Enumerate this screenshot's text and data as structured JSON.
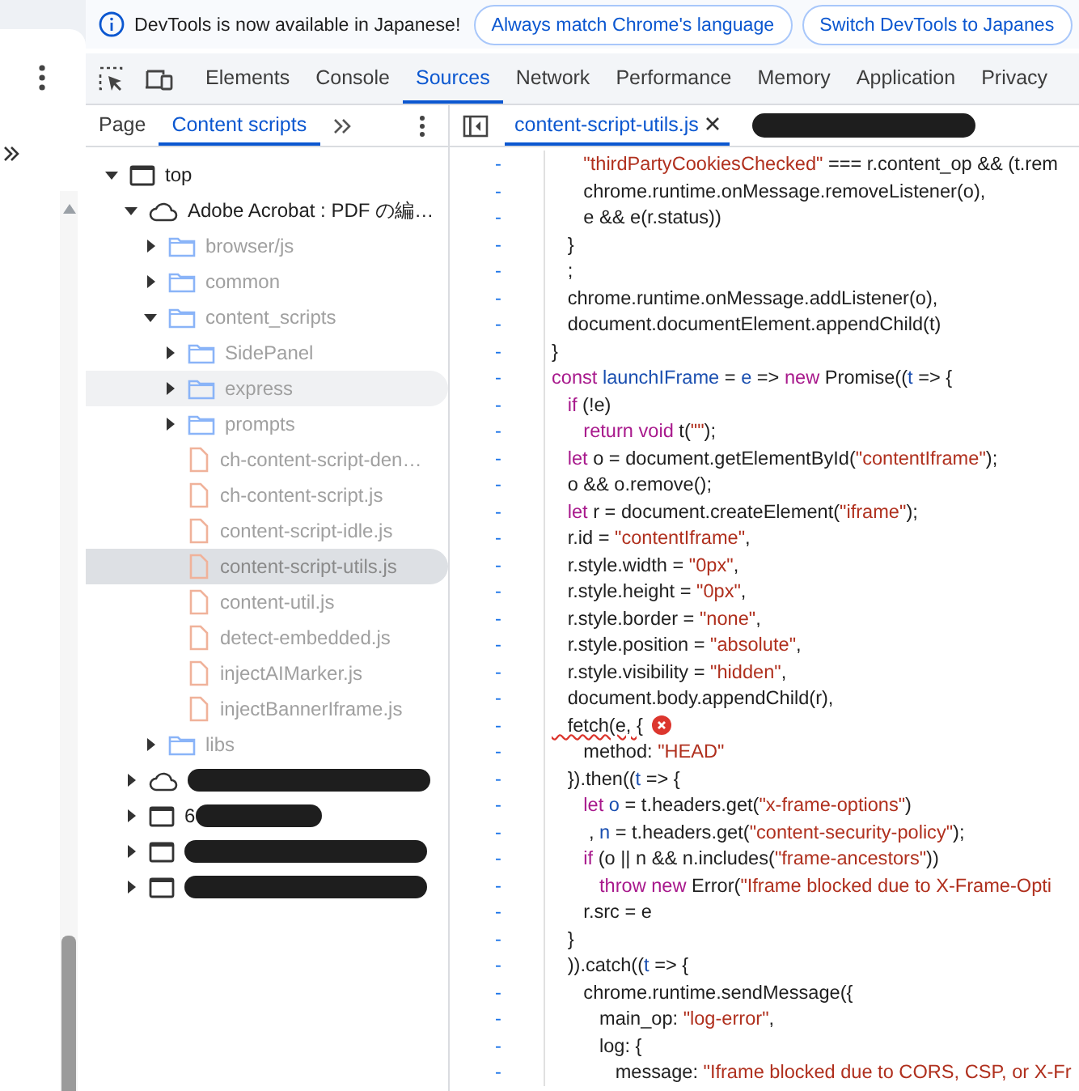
{
  "infobar": {
    "message": "DevTools is now available in Japanese!",
    "buttons": [
      "Always match Chrome's language",
      "Switch DevTools to Japanes"
    ]
  },
  "main_tabs": [
    {
      "label": "Elements",
      "selected": false
    },
    {
      "label": "Console",
      "selected": false
    },
    {
      "label": "Sources",
      "selected": true
    },
    {
      "label": "Network",
      "selected": false
    },
    {
      "label": "Performance",
      "selected": false
    },
    {
      "label": "Memory",
      "selected": false
    },
    {
      "label": "Application",
      "selected": false
    },
    {
      "label": "Privacy",
      "selected": false
    }
  ],
  "navigator_tabs": [
    {
      "label": "Page",
      "selected": false
    },
    {
      "label": "Content scripts",
      "selected": true
    }
  ],
  "editor_tabs": [
    {
      "label": "content-script-utils.js",
      "selected": true
    },
    {
      "redacted": true
    }
  ],
  "tree": [
    {
      "label": "top",
      "kind": "frame",
      "expanded": true,
      "dimmed": false,
      "selected": false,
      "hovered": false,
      "children": [
        {
          "label": "Adobe Acrobat : PDF の編…",
          "kind": "cloud",
          "expanded": true,
          "dimmed": false,
          "selected": false,
          "hovered": false,
          "children": [
            {
              "label": "browser/js",
              "kind": "folder",
              "expanded": false,
              "dimmed": true,
              "selected": false,
              "hovered": false
            },
            {
              "label": "common",
              "kind": "folder",
              "expanded": false,
              "dimmed": true,
              "selected": false,
              "hovered": false
            },
            {
              "label": "content_scripts",
              "kind": "folder",
              "expanded": true,
              "dimmed": true,
              "selected": false,
              "hovered": false,
              "children": [
                {
                  "label": "SidePanel",
                  "kind": "folder",
                  "expanded": false,
                  "dimmed": true,
                  "selected": false,
                  "hovered": false
                },
                {
                  "label": "express",
                  "kind": "folder",
                  "expanded": false,
                  "dimmed": true,
                  "selected": false,
                  "hovered": true
                },
                {
                  "label": "prompts",
                  "kind": "folder",
                  "expanded": false,
                  "dimmed": true,
                  "selected": false,
                  "hovered": false
                },
                {
                  "label": "ch-content-script-den…",
                  "kind": "file",
                  "dimmed": true,
                  "selected": false,
                  "hovered": false
                },
                {
                  "label": "ch-content-script.js",
                  "kind": "file",
                  "dimmed": true,
                  "selected": false,
                  "hovered": false
                },
                {
                  "label": "content-script-idle.js",
                  "kind": "file",
                  "dimmed": true,
                  "selected": false,
                  "hovered": false
                },
                {
                  "label": "content-script-utils.js",
                  "kind": "file",
                  "dimmed": true,
                  "selected": true,
                  "hovered": false
                },
                {
                  "label": "content-util.js",
                  "kind": "file",
                  "dimmed": true,
                  "selected": false,
                  "hovered": false
                },
                {
                  "label": "detect-embedded.js",
                  "kind": "file",
                  "dimmed": true,
                  "selected": false,
                  "hovered": false
                },
                {
                  "label": "injectAIMarker.js",
                  "kind": "file",
                  "dimmed": true,
                  "selected": false,
                  "hovered": false
                },
                {
                  "label": "injectBannerIframe.js",
                  "kind": "file",
                  "dimmed": true,
                  "selected": false,
                  "hovered": false
                }
              ]
            },
            {
              "label": "libs",
              "kind": "folder",
              "expanded": false,
              "dimmed": true,
              "selected": false,
              "hovered": false
            }
          ]
        },
        {
          "kind": "cloud",
          "expanded": false,
          "dimmed": false,
          "selected": false,
          "hovered": false,
          "redacted": true
        },
        {
          "label": "6",
          "kind": "frame",
          "expanded": false,
          "dimmed": false,
          "selected": false,
          "hovered": false,
          "redacted": true
        },
        {
          "kind": "frame",
          "expanded": false,
          "dimmed": false,
          "selected": false,
          "hovered": false,
          "redacted": true
        },
        {
          "kind": "frame",
          "expanded": false,
          "dimmed": false,
          "selected": false,
          "hovered": false,
          "redacted": true
        }
      ]
    }
  ],
  "code_lines": [
    {
      "marker": "-",
      "tokens": [
        {
          "text": "      \"thirdPartyCookiesChecked\"",
          "kind": "string"
        },
        {
          "text": " === r.content_op && (t.rem",
          "kind": "plain"
        }
      ]
    },
    {
      "marker": "-",
      "tokens": [
        {
          "text": "      chrome.runtime.onMessage.removeListener(o),",
          "kind": "plain"
        }
      ]
    },
    {
      "marker": "-",
      "tokens": [
        {
          "text": "      e && e(r.status))",
          "kind": "plain"
        }
      ]
    },
    {
      "marker": "-",
      "tokens": [
        {
          "text": "   }",
          "kind": "plain"
        }
      ]
    },
    {
      "marker": "-",
      "tokens": [
        {
          "text": "   ;",
          "kind": "plain"
        }
      ]
    },
    {
      "marker": "-",
      "tokens": [
        {
          "text": "   chrome.runtime.onMessage.addListener(o),",
          "kind": "plain"
        }
      ]
    },
    {
      "marker": "-",
      "tokens": [
        {
          "text": "   document.documentElement.appendChild(t)",
          "kind": "plain"
        }
      ]
    },
    {
      "marker": "-",
      "tokens": [
        {
          "text": "}",
          "kind": "plain"
        }
      ]
    },
    {
      "marker": "-",
      "tokens": [
        {
          "text": "const ",
          "kind": "keyword"
        },
        {
          "text": "launchIFrame",
          "kind": "definition"
        },
        {
          "text": " = ",
          "kind": "plain"
        },
        {
          "text": "e",
          "kind": "definition"
        },
        {
          "text": " => ",
          "kind": "plain"
        },
        {
          "text": "new",
          "kind": "keyword"
        },
        {
          "text": " Promise((",
          "kind": "plain"
        },
        {
          "text": "t",
          "kind": "definition"
        },
        {
          "text": " => {",
          "kind": "plain"
        }
      ]
    },
    {
      "marker": "-",
      "tokens": [
        {
          "text": "   if",
          "kind": "keyword"
        },
        {
          "text": " (!e)",
          "kind": "plain"
        }
      ]
    },
    {
      "marker": "-",
      "tokens": [
        {
          "text": "      return void",
          "kind": "keyword"
        },
        {
          "text": " t(",
          "kind": "plain"
        },
        {
          "text": "\"\"",
          "kind": "string"
        },
        {
          "text": ");",
          "kind": "plain"
        }
      ]
    },
    {
      "marker": "-",
      "tokens": [
        {
          "text": "   let",
          "kind": "keyword"
        },
        {
          "text": " o = document.getElementById(",
          "kind": "plain"
        },
        {
          "text": "\"contentIframe\"",
          "kind": "string"
        },
        {
          "text": ");",
          "kind": "plain"
        }
      ]
    },
    {
      "marker": "-",
      "tokens": [
        {
          "text": "   o && o.remove();",
          "kind": "plain"
        }
      ]
    },
    {
      "marker": "-",
      "tokens": [
        {
          "text": "   let",
          "kind": "keyword"
        },
        {
          "text": " r = document.createElement(",
          "kind": "plain"
        },
        {
          "text": "\"iframe\"",
          "kind": "string"
        },
        {
          "text": ");",
          "kind": "plain"
        }
      ]
    },
    {
      "marker": "-",
      "tokens": [
        {
          "text": "   r.id = ",
          "kind": "plain"
        },
        {
          "text": "\"contentIframe\"",
          "kind": "string"
        },
        {
          "text": ",",
          "kind": "plain"
        }
      ]
    },
    {
      "marker": "-",
      "tokens": [
        {
          "text": "   r.style.width = ",
          "kind": "plain"
        },
        {
          "text": "\"0px\"",
          "kind": "string"
        },
        {
          "text": ",",
          "kind": "plain"
        }
      ]
    },
    {
      "marker": "-",
      "tokens": [
        {
          "text": "   r.style.height = ",
          "kind": "plain"
        },
        {
          "text": "\"0px\"",
          "kind": "string"
        },
        {
          "text": ",",
          "kind": "plain"
        }
      ]
    },
    {
      "marker": "-",
      "tokens": [
        {
          "text": "   r.style.border = ",
          "kind": "plain"
        },
        {
          "text": "\"none\"",
          "kind": "string"
        },
        {
          "text": ",",
          "kind": "plain"
        }
      ]
    },
    {
      "marker": "-",
      "tokens": [
        {
          "text": "   r.style.position = ",
          "kind": "plain"
        },
        {
          "text": "\"absolute\"",
          "kind": "string"
        },
        {
          "text": ",",
          "kind": "plain"
        }
      ]
    },
    {
      "marker": "-",
      "tokens": [
        {
          "text": "   r.style.visibility = ",
          "kind": "plain"
        },
        {
          "text": "\"hidden\"",
          "kind": "string"
        },
        {
          "text": ",",
          "kind": "plain"
        }
      ]
    },
    {
      "marker": "-",
      "tokens": [
        {
          "text": "   document.body.appendChild(r),",
          "kind": "plain"
        }
      ]
    },
    {
      "marker": "-",
      "error": true,
      "tokens": [
        {
          "text": "   fetch(e, {",
          "kind": "plain"
        }
      ]
    },
    {
      "marker": "-",
      "tokens": [
        {
          "text": "      method: ",
          "kind": "plain"
        },
        {
          "text": "\"HEAD\"",
          "kind": "string"
        }
      ]
    },
    {
      "marker": "-",
      "tokens": [
        {
          "text": "   }).then((",
          "kind": "plain"
        },
        {
          "text": "t",
          "kind": "definition"
        },
        {
          "text": " => {",
          "kind": "plain"
        }
      ]
    },
    {
      "marker": "-",
      "tokens": [
        {
          "text": "      let ",
          "kind": "keyword"
        },
        {
          "text": "o",
          "kind": "definition"
        },
        {
          "text": " = t.headers.get(",
          "kind": "plain"
        },
        {
          "text": "\"x-frame-options\"",
          "kind": "string"
        },
        {
          "text": ")",
          "kind": "plain"
        }
      ]
    },
    {
      "marker": "-",
      "tokens": [
        {
          "text": "       , ",
          "kind": "plain"
        },
        {
          "text": "n",
          "kind": "definition"
        },
        {
          "text": " = t.headers.get(",
          "kind": "plain"
        },
        {
          "text": "\"content-security-policy\"",
          "kind": "string"
        },
        {
          "text": ");",
          "kind": "plain"
        }
      ]
    },
    {
      "marker": "-",
      "tokens": [
        {
          "text": "      if",
          "kind": "keyword"
        },
        {
          "text": " (o || n && n.includes(",
          "kind": "plain"
        },
        {
          "text": "\"frame-ancestors\"",
          "kind": "string"
        },
        {
          "text": "))",
          "kind": "plain"
        }
      ]
    },
    {
      "marker": "-",
      "tokens": [
        {
          "text": "         throw new",
          "kind": "keyword"
        },
        {
          "text": " Error(",
          "kind": "plain"
        },
        {
          "text": "\"Iframe blocked due to X-Frame-Opti",
          "kind": "string"
        }
      ]
    },
    {
      "marker": "-",
      "tokens": [
        {
          "text": "      r.src = e",
          "kind": "plain"
        }
      ]
    },
    {
      "marker": "-",
      "tokens": [
        {
          "text": "   }",
          "kind": "plain"
        }
      ]
    },
    {
      "marker": "-",
      "tokens": [
        {
          "text": "   )).catch((",
          "kind": "plain"
        },
        {
          "text": "t",
          "kind": "definition"
        },
        {
          "text": " => {",
          "kind": "plain"
        }
      ]
    },
    {
      "marker": "-",
      "tokens": [
        {
          "text": "      chrome.runtime.sendMessage({",
          "kind": "plain"
        }
      ]
    },
    {
      "marker": "-",
      "tokens": [
        {
          "text": "         main_op: ",
          "kind": "plain"
        },
        {
          "text": "\"log-error\"",
          "kind": "string"
        },
        {
          "text": ",",
          "kind": "plain"
        }
      ]
    },
    {
      "marker": "-",
      "tokens": [
        {
          "text": "         log: {",
          "kind": "plain"
        }
      ]
    },
    {
      "marker": "-",
      "tokens": [
        {
          "text": "            message: ",
          "kind": "plain"
        },
        {
          "text": "\"Iframe blocked due to CORS, CSP, or X-Fr",
          "kind": "string"
        }
      ]
    }
  ]
}
